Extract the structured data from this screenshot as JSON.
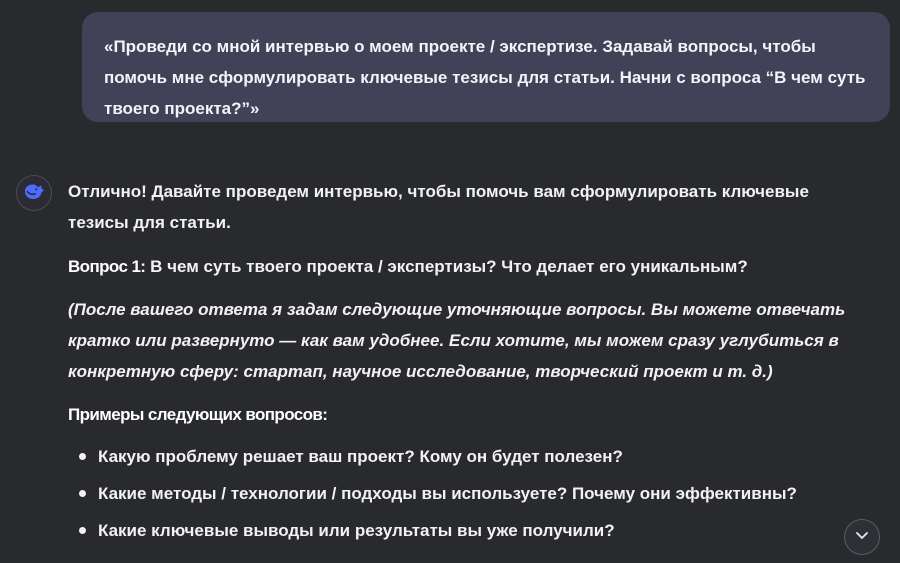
{
  "user_message": {
    "text": "«Проведи со мной интервью о моем проекте / экспертизе. Задавай вопросы, чтобы помочь мне сформулировать ключевые тезисы для статьи. Начни с вопроса “В чем суть твоего проекта?”»"
  },
  "assistant": {
    "avatar_icon": "whale-icon",
    "intro": "Отлично! Давайте проведем интервью, чтобы помочь вам сформулировать ключевые тезисы для статьи.",
    "question_label": "Вопрос 1:",
    "question_text": " В чем суть твоего проекта / экспертизы? Что делает его уникальным?",
    "note": "(После вашего ответа я задам следующие уточняющие вопросы. Вы можете отвечать кратко или развернуто — как вам удобнее. Если хотите, мы можем сразу углубиться в конкретную сферу: стартап, научное исследование, творческий проект и т. д.)",
    "examples_title": "Примеры следующих вопросов:",
    "examples": [
      "Какую проблему решает ваш проект? Кому он будет полезен?",
      "Какие методы / технологии / подходы вы используете? Почему они эффективны?",
      "Какие ключевые выводы или результаты вы уже получили?"
    ]
  },
  "scroll_button": {
    "icon": "chevron-down-icon"
  },
  "colors": {
    "background": "#292a2d",
    "user_bubble": "#414158",
    "avatar_accent": "#4d6bfe",
    "text": "#f2f2f2"
  }
}
